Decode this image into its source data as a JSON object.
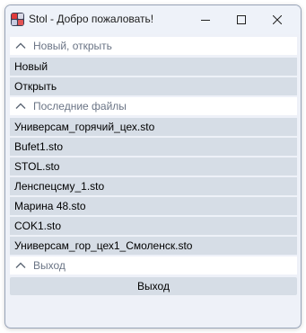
{
  "window": {
    "title": "Stol - Добро пожаловать!"
  },
  "icons": {
    "app": "app-logo-icon",
    "minimize": "minimize-icon",
    "maximize": "maximize-icon",
    "close": "close-icon",
    "collapse": "chevron-up-icon"
  },
  "sections": {
    "new_open": {
      "title": "Новый, открыть",
      "items": [
        "Новый",
        "Открыть"
      ]
    },
    "recent": {
      "title": "Последние файлы",
      "items": [
        "Универсам_горячий_цех.sto",
        "Bufet1.sto",
        "STOL.sto",
        "Ленспецсму_1.sto",
        "Марина 48.sto",
        "COK1.sto",
        "Универсам_гор_цех1_Смоленск.sto"
      ]
    },
    "exit": {
      "title": "Выход",
      "button_label": "Выход"
    }
  },
  "colors": {
    "row_bg": "#d6dde6",
    "header_text": "#6a7485",
    "window_bg": "#eef1f8"
  }
}
